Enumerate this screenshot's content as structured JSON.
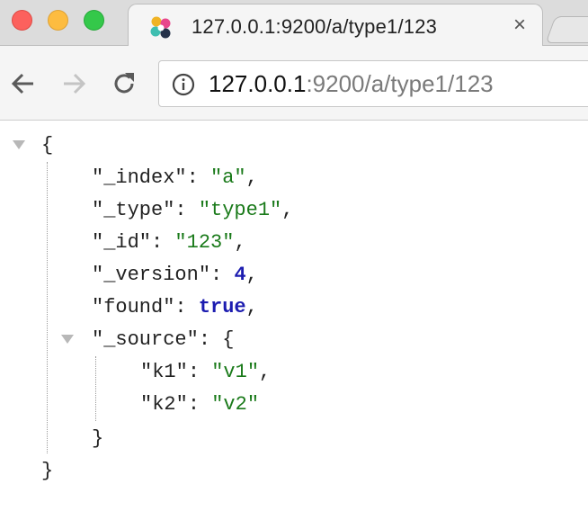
{
  "tab": {
    "title": "127.0.0.1:9200/a/type1/123",
    "close_glyph": "×"
  },
  "omnibox": {
    "host": "127.0.0.1",
    "path": ":9200/a/type1/123"
  },
  "json": {
    "open_brace": "{",
    "close_brace": "}",
    "index_key": "\"_index\"",
    "index_value": "\"a\"",
    "type_key": "\"_type\"",
    "type_value": "\"type1\"",
    "id_key": "\"_id\"",
    "id_value": "\"123\"",
    "version_key": "\"_version\"",
    "version_value": "4",
    "found_key": "\"found\"",
    "found_value": "true",
    "source_key": "\"_source\"",
    "k1_key": "\"k1\"",
    "k1_value": "\"v1\"",
    "k2_key": "\"k2\"",
    "k2_value": "\"v2\"",
    "colon": ": ",
    "comma": ","
  },
  "colors": {
    "string": "#1a7a1a",
    "number": "#1c1cb0",
    "key": "#222222"
  }
}
